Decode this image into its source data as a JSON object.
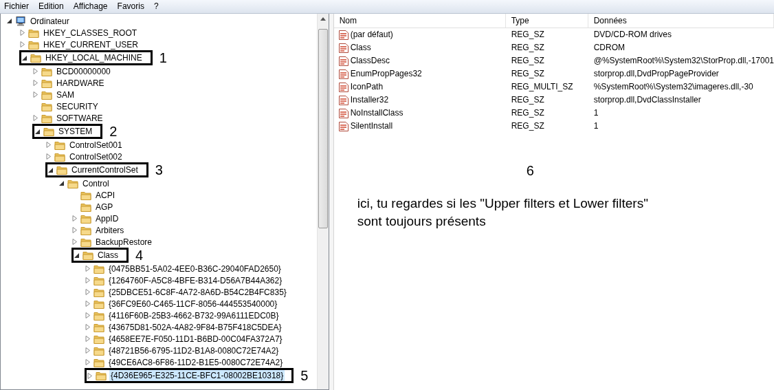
{
  "menu": [
    "Fichier",
    "Edition",
    "Affichage",
    "Favoris",
    "?"
  ],
  "tree": {
    "label": "Ordinateur",
    "kind": "computer",
    "expanded": true,
    "selected": false,
    "children": [
      {
        "label": "HKEY_CLASSES_ROOT",
        "expanded": false,
        "selected": false
      },
      {
        "label": "HKEY_CURRENT_USER",
        "expanded": false,
        "selected": false
      },
      {
        "label": "HKEY_LOCAL_MACHINE",
        "expanded": true,
        "selected": false,
        "marker": "1",
        "children": [
          {
            "label": "BCD00000000",
            "expanded": false,
            "selected": false
          },
          {
            "label": "HARDWARE",
            "expanded": false,
            "selected": false
          },
          {
            "label": "SAM",
            "expanded": false,
            "selected": false
          },
          {
            "label": "SECURITY",
            "selected": false
          },
          {
            "label": "SOFTWARE",
            "expanded": false,
            "selected": false
          },
          {
            "label": "SYSTEM",
            "expanded": true,
            "selected": false,
            "marker": "2",
            "children": [
              {
                "label": "ControlSet001",
                "expanded": false,
                "selected": false
              },
              {
                "label": "ControlSet002",
                "expanded": false,
                "selected": false
              },
              {
                "label": "CurrentControlSet",
                "expanded": true,
                "selected": false,
                "marker": "3",
                "children": [
                  {
                    "label": "Control",
                    "expanded": true,
                    "selected": false,
                    "children": [
                      {
                        "label": "ACPI",
                        "selected": false
                      },
                      {
                        "label": "AGP",
                        "selected": false
                      },
                      {
                        "label": "AppID",
                        "expanded": false,
                        "selected": false
                      },
                      {
                        "label": "Arbiters",
                        "expanded": false,
                        "selected": false
                      },
                      {
                        "label": "BackupRestore",
                        "expanded": false,
                        "selected": false
                      },
                      {
                        "label": "Class",
                        "expanded": true,
                        "selected": false,
                        "marker": "4",
                        "children": [
                          {
                            "label": "{0475BB51-5A02-4EE0-B36C-29040FAD2650}",
                            "expanded": false,
                            "selected": false
                          },
                          {
                            "label": "{1264760F-A5C8-4BFE-B314-D56A7B44A362}",
                            "expanded": false,
                            "selected": false
                          },
                          {
                            "label": "{25DBCE51-6C8F-4A72-8A6D-B54C2B4FC835}",
                            "expanded": false,
                            "selected": false
                          },
                          {
                            "label": "{36FC9E60-C465-11CF-8056-444553540000}",
                            "expanded": false,
                            "selected": false
                          },
                          {
                            "label": "{4116F60B-25B3-4662-B732-99A6111EDC0B}",
                            "expanded": false,
                            "selected": false
                          },
                          {
                            "label": "{43675D81-502A-4A82-9F84-B75F418C5DEA}",
                            "expanded": false,
                            "selected": false
                          },
                          {
                            "label": "{4658EE7E-F050-11D1-B6BD-00C04FA372A7}",
                            "expanded": false,
                            "selected": false
                          },
                          {
                            "label": "{48721B56-6795-11D2-B1A8-0080C72E74A2}",
                            "expanded": false,
                            "selected": false
                          },
                          {
                            "label": "{49CE6AC8-6F86-11D2-B1E5-0080C72E74A2}",
                            "expanded": false,
                            "selected": false
                          },
                          {
                            "label": "{4D36E965-E325-11CE-BFC1-08002BE10318}",
                            "expanded": false,
                            "selected": true,
                            "marker": "5"
                          }
                        ]
                      }
                    ]
                  }
                ]
              }
            ]
          }
        ]
      }
    ]
  },
  "values": {
    "columns": [
      "Nom",
      "Type",
      "Données"
    ],
    "rows": [
      {
        "name": "(par défaut)",
        "type": "REG_SZ",
        "data": "DVD/CD-ROM drives"
      },
      {
        "name": "Class",
        "type": "REG_SZ",
        "data": "CDROM"
      },
      {
        "name": "ClassDesc",
        "type": "REG_SZ",
        "data": "@%SystemRoot%\\System32\\StorProp.dll,-17001"
      },
      {
        "name": "EnumPropPages32",
        "type": "REG_SZ",
        "data": "storprop.dll,DvdPropPageProvider"
      },
      {
        "name": "IconPath",
        "type": "REG_MULTI_SZ",
        "data": "%SystemRoot%\\System32\\imageres.dll,-30"
      },
      {
        "name": "Installer32",
        "type": "REG_SZ",
        "data": "storprop.dll,DvdClassInstaller"
      },
      {
        "name": "NoInstallClass",
        "type": "REG_SZ",
        "data": "1"
      },
      {
        "name": "SilentInstall",
        "type": "REG_SZ",
        "data": "1"
      }
    ],
    "marker": "6",
    "note": "ici, tu regardes si les \"Upper filters et Lower filters\"\nsont toujours présents"
  }
}
